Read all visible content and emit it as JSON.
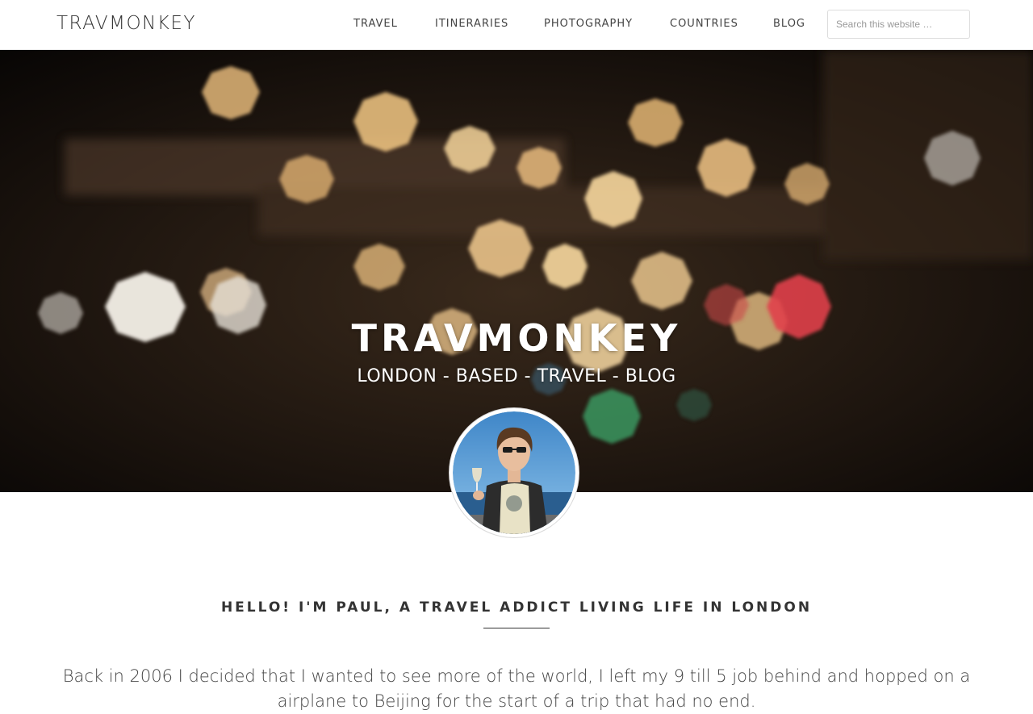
{
  "site": {
    "logo": "TRAVMONKEY"
  },
  "nav": {
    "items": [
      {
        "label": "TRAVEL"
      },
      {
        "label": "ITINERARIES"
      },
      {
        "label": "PHOTOGRAPHY"
      },
      {
        "label": "COUNTRIES"
      },
      {
        "label": "BLOG"
      }
    ]
  },
  "search": {
    "placeholder": "Search this website …",
    "value": ""
  },
  "hero": {
    "title": "TRAVMONKEY",
    "tagline": "LONDON - BASED - TRAVEL - BLOG"
  },
  "intro": {
    "heading": "HELLO! I'M PAUL, A TRAVEL ADDICT LIVING LIFE IN LONDON",
    "text": "Back in 2006 I decided that I wanted to see more of the world, I left my 9 till 5 job behind and hopped on a airplane to Beijing for the start of a trip that had no end."
  },
  "colors": {
    "text": "#333333",
    "hero_background": "#120d0a",
    "bokeh_warm": "#f3c884",
    "bokeh_red": "#e0404a",
    "bokeh_green": "#3fa86b"
  }
}
